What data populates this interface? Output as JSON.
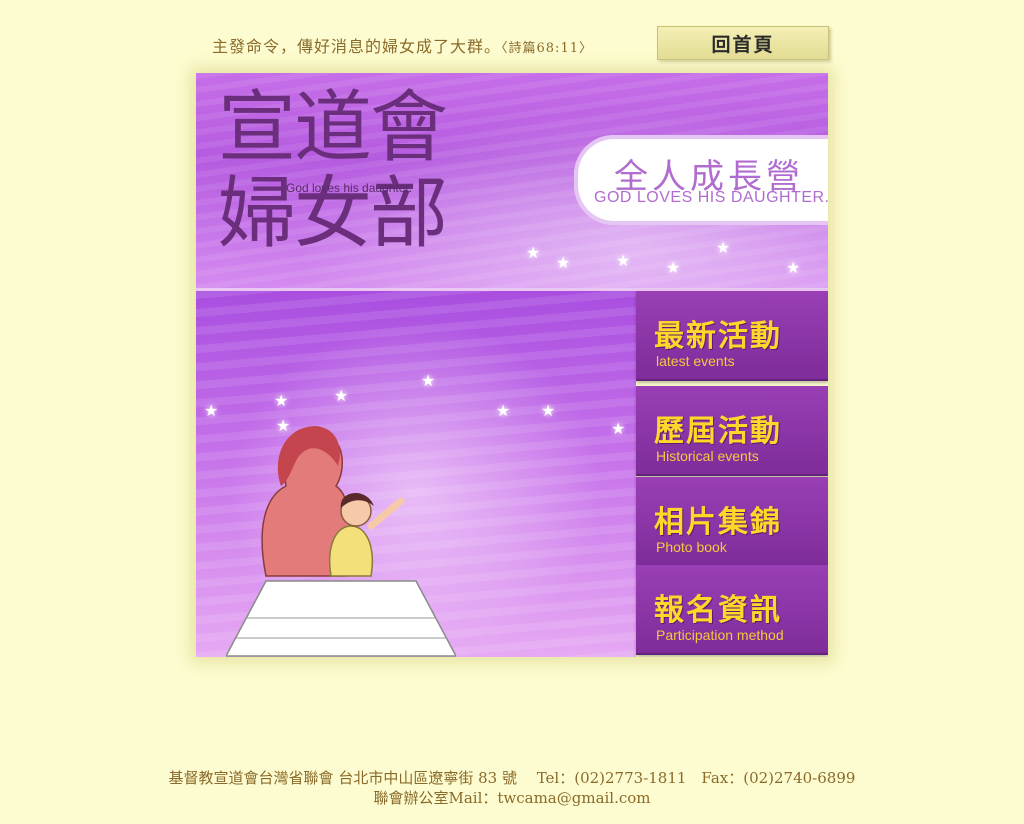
{
  "header": {
    "verse": "主發命令，傳好消息的婦女成了大群。",
    "verse_ref": "〈詩篇68:11〉",
    "home_button": "回首頁"
  },
  "banner": {
    "logo_line1": "宣道會",
    "logo_line2": "婦女部",
    "logo_subtitle": "God loves his daughter.",
    "badge_title": "全人成長營",
    "badge_subtitle": "GOD LOVES HIS DAUGHTER."
  },
  "menu": {
    "items": [
      {
        "zh": "最新活動",
        "en": "latest events"
      },
      {
        "zh": "歷屆活動",
        "en": "Historical events"
      },
      {
        "zh": "相片集錦",
        "en": "Photo book"
      },
      {
        "zh": "報名資訊",
        "en": "Participation method"
      }
    ]
  },
  "footer": {
    "line1": "基督教宣道會台灣省聯會 台北市中山區遼寧街 83 號　 Tel：(02)2773-1811　Fax：(02)2740-6899",
    "line2": "聯會辦公室Mail：twcama@gmail.com"
  }
}
